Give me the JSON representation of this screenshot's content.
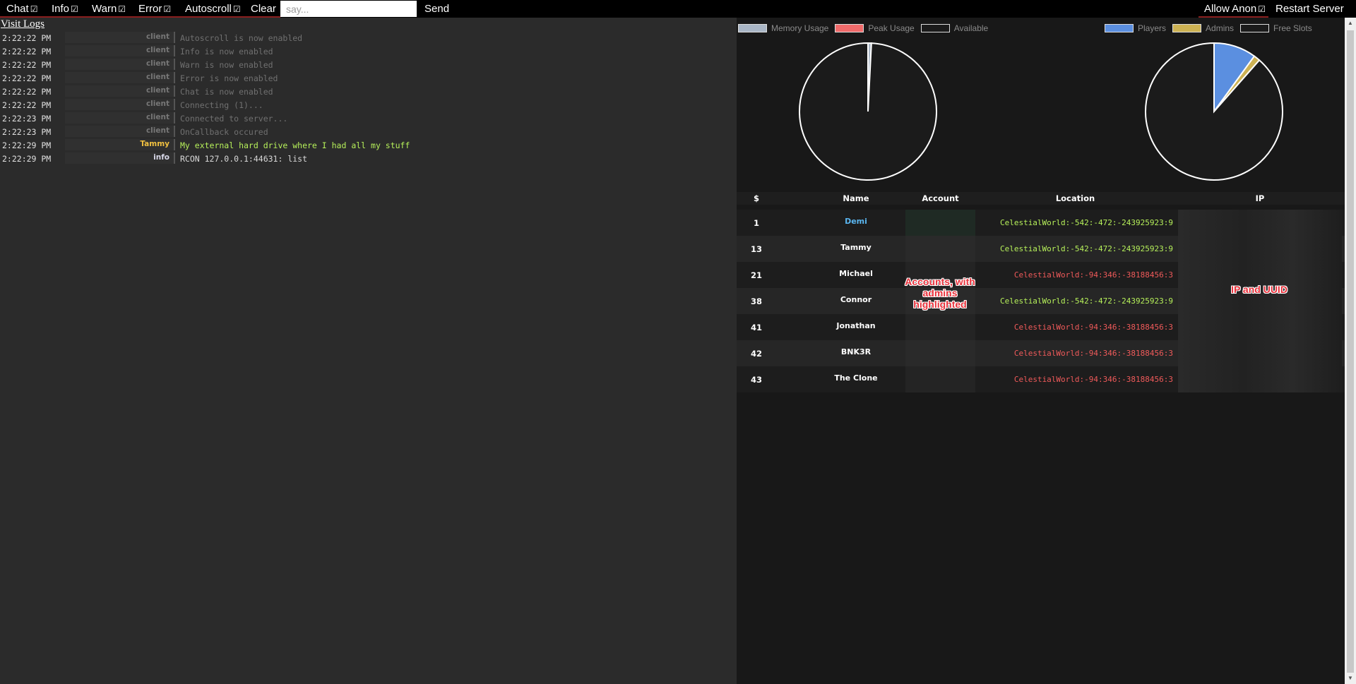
{
  "toolbar": {
    "chat": "Chat",
    "info": "Info",
    "warn": "Warn",
    "error": "Error",
    "autoscroll": "Autoscroll",
    "check": "☑",
    "clear": "Clear",
    "say_placeholder": "say...",
    "send": "Send",
    "allow_anon": "Allow Anon",
    "restart_server": "Restart Server"
  },
  "visit_logs": "Visit Logs",
  "logs": [
    {
      "time": "2:22:22 PM",
      "source": "client",
      "message": "Autoscroll is now enabled",
      "kind": "client"
    },
    {
      "time": "2:22:22 PM",
      "source": "client",
      "message": "Info is now enabled",
      "kind": "client"
    },
    {
      "time": "2:22:22 PM",
      "source": "client",
      "message": "Warn is now enabled",
      "kind": "client"
    },
    {
      "time": "2:22:22 PM",
      "source": "client",
      "message": "Error is now enabled",
      "kind": "client"
    },
    {
      "time": "2:22:22 PM",
      "source": "client",
      "message": "Chat is now enabled",
      "kind": "client"
    },
    {
      "time": "2:22:22 PM",
      "source": "client",
      "message": "Connecting (1)...",
      "kind": "client"
    },
    {
      "time": "2:22:23 PM",
      "source": "client",
      "message": "Connected to server...",
      "kind": "client"
    },
    {
      "time": "2:22:23 PM",
      "source": "client",
      "message": "OnCallback occured",
      "kind": "client"
    },
    {
      "time": "2:22:29 PM",
      "source": "Tammy",
      "message": "My external hard drive where I had all my stuff",
      "kind": "chat"
    },
    {
      "time": "2:22:29 PM",
      "source": "info",
      "message": "RCON 127.0.0.1:44631: list",
      "kind": "info"
    }
  ],
  "memory_legend": [
    "Memory Usage",
    "Peak Usage",
    "Available"
  ],
  "players_legend": [
    "Players",
    "Admins",
    "Free Slots"
  ],
  "colors": {
    "memory": "#a9b6c6",
    "peak": "#f06a6a",
    "players": "#5b8fe0",
    "admins": "#cdb253",
    "free": "#1b1b1b",
    "loc_green": "#b6f05a",
    "loc_red": "#f05a5a",
    "demi": "#5ab6f0"
  },
  "memory_chart": {
    "type": "pie",
    "values": [
      {
        "label": "Memory Usage",
        "value": 0.8
      },
      {
        "label": "Peak Usage",
        "value": 0
      },
      {
        "label": "Available",
        "value": 99.2
      }
    ]
  },
  "players_chart": {
    "type": "pie",
    "values": [
      {
        "label": "Players",
        "value": 10
      },
      {
        "label": "Admins",
        "value": 1.5
      },
      {
        "label": "Free Slots",
        "value": 88.5
      }
    ]
  },
  "table": {
    "headers": {
      "num": "$",
      "name": "Name",
      "account": "Account",
      "location": "Location",
      "ip": "IP"
    },
    "rows": [
      {
        "num": "1",
        "name": "Demi",
        "location": "CelestialWorld:-542:-472:-243925923:9",
        "loc": "green",
        "special": true
      },
      {
        "num": "13",
        "name": "Tammy",
        "location": "CelestialWorld:-542:-472:-243925923:9",
        "loc": "green"
      },
      {
        "num": "21",
        "name": "Michael",
        "location": "CelestialWorld:-94:346:-38188456:3",
        "loc": "red"
      },
      {
        "num": "38",
        "name": "Connor",
        "location": "CelestialWorld:-542:-472:-243925923:9",
        "loc": "green"
      },
      {
        "num": "41",
        "name": "Jonathan",
        "location": "CelestialWorld:-94:346:-38188456:3",
        "loc": "red"
      },
      {
        "num": "42",
        "name": "BNK3R",
        "location": "CelestialWorld:-94:346:-38188456:3",
        "loc": "red"
      },
      {
        "num": "43",
        "name": "The Clone",
        "location": "CelestialWorld:-94:346:-38188456:3",
        "loc": "red"
      }
    ]
  },
  "annotations": {
    "accounts": "Accounts, with admins highlighted",
    "ip": "IP and UUID"
  }
}
